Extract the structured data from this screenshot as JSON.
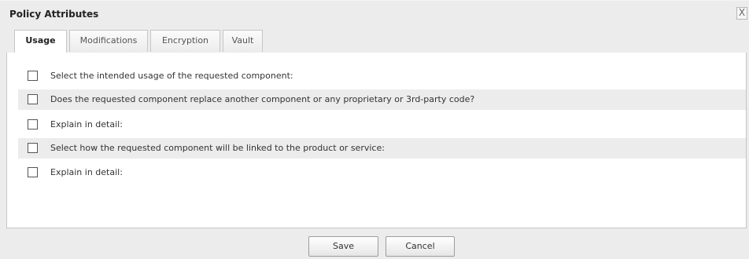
{
  "dialog": {
    "title": "Policy Attributes",
    "close_label": "X"
  },
  "tabs": [
    {
      "label": "Usage",
      "active": true
    },
    {
      "label": "Modifications",
      "active": false
    },
    {
      "label": "Encryption",
      "active": false
    },
    {
      "label": "Vault",
      "active": false
    }
  ],
  "items": [
    {
      "label": "Select the intended usage of the requested component:",
      "checked": false
    },
    {
      "label": "Does the requested component replace another component or any proprietary or 3rd-party code?",
      "checked": false
    },
    {
      "label": "Explain in detail:",
      "checked": false
    },
    {
      "label": "Select how the requested component will be linked to the product or service:",
      "checked": false
    },
    {
      "label": "Explain in detail:",
      "checked": false
    }
  ],
  "buttons": {
    "save_label": "Save",
    "cancel_label": "Cancel"
  },
  "colors": {
    "dialog_background": "#ececec",
    "content_background": "#ffffff",
    "row_shade": "#ececec",
    "border": "#c6c6c6"
  }
}
